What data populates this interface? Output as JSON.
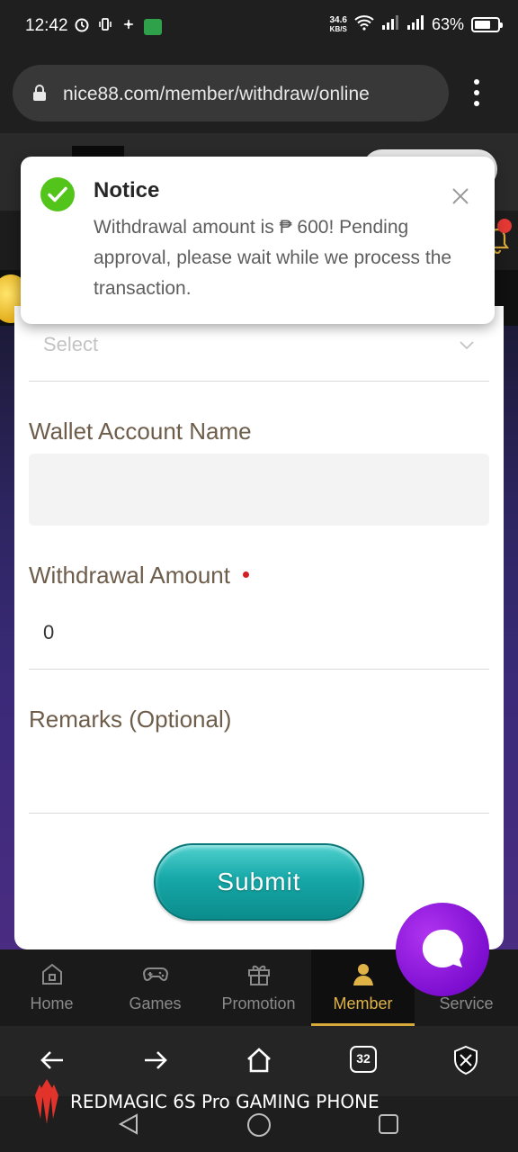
{
  "status_bar": {
    "time": "12:42",
    "net_speed_value": "34.6",
    "net_speed_unit": "KB/S",
    "battery": "63%"
  },
  "browser": {
    "url": "nice88.com/member/withdraw/online"
  },
  "form": {
    "select_placeholder": "Select",
    "wallet_account_name_label": "Wallet Account Name",
    "withdrawal_amount_label": "Withdrawal Amount",
    "withdrawal_amount_value": "0",
    "remarks_label": "Remarks (Optional)",
    "submit_label": "Submit"
  },
  "notice": {
    "title": "Notice",
    "message": "Withdrawal amount is ₱ 600! Pending approval, please wait while we process the transaction."
  },
  "bottom_nav": {
    "items": [
      {
        "label": "Home",
        "icon": "home-icon"
      },
      {
        "label": "Games",
        "icon": "gamepad-icon"
      },
      {
        "label": "Promotion",
        "icon": "gift-icon"
      },
      {
        "label": "Member",
        "icon": "member-icon",
        "active": true
      },
      {
        "label": "Service",
        "icon": "service-icon"
      }
    ]
  },
  "browser_toolbar": {
    "tab_count": "32"
  },
  "watermark": {
    "text": "REDMAGIC 6S Pro GAMING PHONE"
  },
  "colors": {
    "accent_teal": "#17a8a8",
    "active_nav_gold": "#e0b347",
    "label_brown": "#6d5d4a",
    "chat_purple": "#7d0ed0",
    "success_green": "#52c41a"
  }
}
